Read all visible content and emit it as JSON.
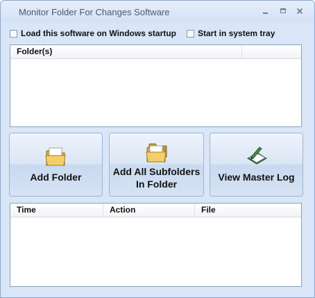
{
  "window": {
    "title": "Monitor Folder For Changes Software"
  },
  "options": {
    "startup_label": "Load this software on Windows startup",
    "tray_label": "Start in system tray"
  },
  "folders_list": {
    "columns": [
      "Folder(s)",
      ""
    ]
  },
  "buttons": {
    "add_folder": "Add Folder",
    "add_subfolders": "Add All Subfolders\nIn Folder",
    "view_log": "View Master Log"
  },
  "log_list": {
    "columns": [
      "Time",
      "Action",
      "File"
    ]
  },
  "icons": {
    "folder": "folder-icon",
    "folders": "folders-icon",
    "log": "log-book-icon",
    "minimize": "minimize-icon",
    "maximize": "maximize-icon",
    "close": "close-icon"
  }
}
